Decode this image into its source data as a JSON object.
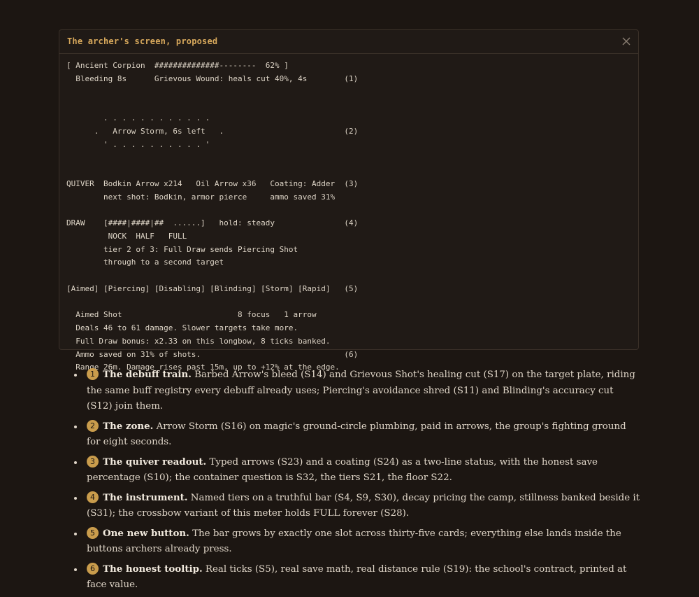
{
  "panel": {
    "title": "The archer's screen, proposed",
    "close_icon": "close-icon",
    "screen_lines": [
      "[ Ancient Corpion  ##############--------  62% ]",
      "  Bleeding 8s      Grievous Wound: heals cut 40%, 4s        (1)",
      "",
      "",
      "        . . . . . . . . . . . .",
      "      .   Arrow Storm, 6s left   .                          (2)",
      "        ' . . . . . . . . . . '",
      "",
      "",
      "QUIVER  Bodkin Arrow x214   Oil Arrow x36   Coating: Adder  (3)",
      "        next shot: Bodkin, armor pierce     ammo saved 31%",
      "",
      "DRAW    [####|####|##  ......]   hold: steady               (4)",
      "         NOCK  HALF   FULL",
      "        tier 2 of 3: Full Draw sends Piercing Shot",
      "        through to a second target",
      "",
      "[Aimed] [Piercing] [Disabling] [Blinding] [Storm] [Rapid]   (5)",
      "",
      "  Aimed Shot                         8 focus   1 arrow",
      "  Deals 46 to 61 damage. Slower targets take more.",
      "  Full Draw bonus: x2.33 on this longbow, 8 ticks banked.",
      "  Ammo saved on 31% of shots.                               (6)",
      "  Range 26m. Damage rises past 15m, up to +12% at the edge."
    ]
  },
  "notes": [
    {
      "badge": "1",
      "title": "The debuff train.",
      "text": " Barbed Arrow's bleed (S14) and Grievous Shot's healing cut (S17) on the target plate, riding the same buff registry every debuff already uses; Piercing's avoidance shred (S11) and Blinding's accuracy cut (S12) join them."
    },
    {
      "badge": "2",
      "title": "The zone.",
      "text": " Arrow Storm (S16) on magic's ground-circle plumbing, paid in arrows, the group's fighting ground for eight seconds."
    },
    {
      "badge": "3",
      "title": "The quiver readout.",
      "text": " Typed arrows (S23) and a coating (S24) as a two-line status, with the honest save percentage (S10); the container question is S32, the tiers S21, the floor S22."
    },
    {
      "badge": "4",
      "title": "The instrument.",
      "text": " Named tiers on a truthful bar (S4, S9, S30), decay pricing the camp, stillness banked beside it (S31); the crossbow variant of this meter holds FULL forever (S28)."
    },
    {
      "badge": "5",
      "title": "One new button.",
      "text": " The bar grows by exactly one slot across thirty-five cards; everything else lands inside the buttons archers already press."
    },
    {
      "badge": "6",
      "title": "The honest tooltip.",
      "text": " Real ticks (S5), real save math, real distance rule (S19): the school's contract, printed at face value."
    }
  ]
}
